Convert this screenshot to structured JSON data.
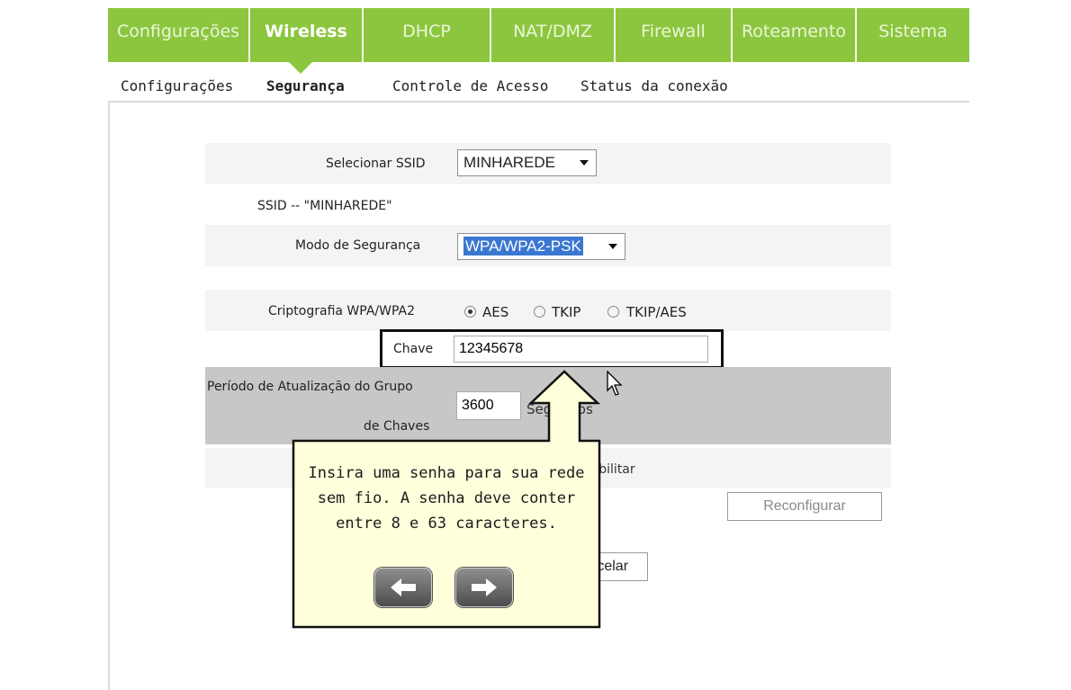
{
  "nav": {
    "tabs": [
      "Configurações",
      "Wireless",
      "DHCP",
      "NAT/DMZ",
      "Firewall",
      "Roteamento",
      "Sistema"
    ],
    "active": "Wireless"
  },
  "subnav": {
    "items": [
      "Configurações",
      "Segurança",
      "Controle de Acesso",
      "Status da conexão"
    ],
    "active": "Segurança"
  },
  "form": {
    "select_ssid_label": "Selecionar SSID",
    "select_ssid_value": "MINHAREDE",
    "ssid_line": "SSID -- \"MINHAREDE\"",
    "security_mode_label": "Modo de Segurança",
    "security_mode_value": "WPA/WPA2-PSK",
    "crypto_label": "Criptografia WPA/WPA2",
    "crypto_options": [
      "AES",
      "TKIP",
      "TKIP/AES"
    ],
    "crypto_selected": "AES",
    "key_label": "Chave",
    "key_value": "12345678",
    "group_period_label_1": "Período de Atualização do Grupo",
    "group_period_label_2": "de Chaves",
    "group_period_value": "3600",
    "group_period_unit": "Segundos",
    "disable_option": "Desabilitar",
    "reconfigure_button": "Reconfigurar",
    "cancel_button": "Cancelar"
  },
  "tutorial": {
    "text": "Insira uma senha para sua rede sem fio. A senha deve conter entre 8 e 63 caracteres.",
    "prev_icon": "arrow-left-icon",
    "next_icon": "arrow-right-icon"
  },
  "colors": {
    "nav_green": "#8cc63f",
    "callout_fill": "#ffffdc",
    "gray_row": "#c7c7c7",
    "selection_blue": "#3a77d1"
  }
}
